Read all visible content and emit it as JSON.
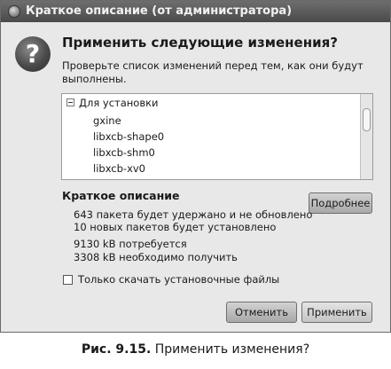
{
  "window": {
    "title": "Краткое описание (от администратора)"
  },
  "dialog": {
    "heading": "Применить следующие изменения?",
    "subtext": "Проверьте список изменений перед тем, как они будут выполнены."
  },
  "changes": {
    "group_label": "Для установки",
    "items": [
      "gxine",
      "libxcb-shape0",
      "libxcb-shm0",
      "libxcb-xv0"
    ]
  },
  "summary": {
    "title": "Краткое описание",
    "details_button": "Подробнее",
    "lines": [
      "643 пакета будет удержано и не обновлено",
      "10 новых пакетов будет установлено",
      "9130 kB потребуется",
      "3308 kB необходимо получить"
    ]
  },
  "download_only": {
    "label": "Только скачать установочные файлы",
    "checked": false
  },
  "buttons": {
    "cancel": "Отменить",
    "apply": "Применить"
  },
  "caption": {
    "number": "Рис. 9.15.",
    "text": "Применить изменения?"
  }
}
